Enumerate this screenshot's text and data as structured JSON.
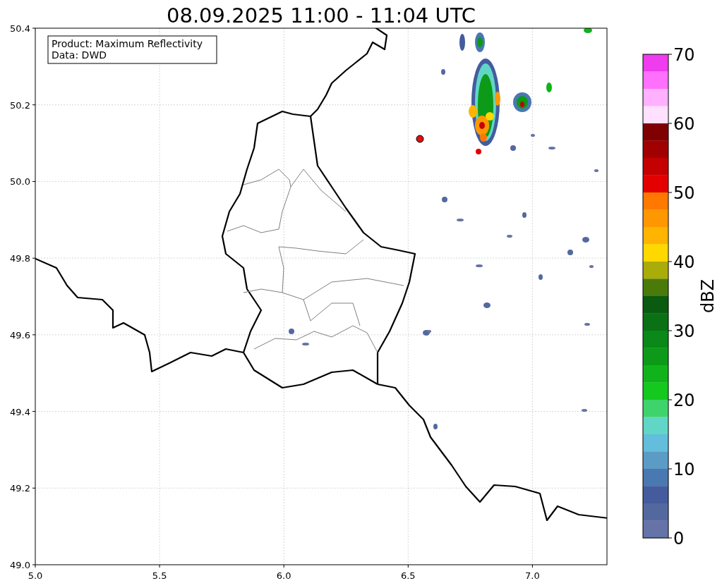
{
  "title": "08.09.2025 11:00 - 11:04 UTC",
  "info_box": [
    "Product: Maximum Reflectivity",
    "Data: DWD"
  ],
  "map": {
    "x_ticks": [
      "5.0",
      "5.5",
      "6.0",
      "6.5",
      "7.0"
    ],
    "y_ticks": [
      "50.4",
      "50.2",
      "50.0",
      "49.8",
      "49.6",
      "49.4",
      "49.2",
      "49.0"
    ]
  },
  "colorbar": {
    "label": "dBZ",
    "ticks": [
      "70",
      "60",
      "50",
      "40",
      "30",
      "20",
      "10",
      "0"
    ],
    "steps": [
      {
        "color": "#ee3cee"
      },
      {
        "color": "#ff70fe"
      },
      {
        "color": "#ffb0fe"
      },
      {
        "color": "#ffe0fe"
      },
      {
        "color": "#7e0000"
      },
      {
        "color": "#a00000"
      },
      {
        "color": "#c40000"
      },
      {
        "color": "#e40000"
      },
      {
        "color": "#ff7800"
      },
      {
        "color": "#ff9800"
      },
      {
        "color": "#ffb400"
      },
      {
        "color": "#ffd800"
      },
      {
        "color": "#aaac0a"
      },
      {
        "color": "#4a7a0a"
      },
      {
        "color": "#0a5a10"
      },
      {
        "color": "#0a7214"
      },
      {
        "color": "#0a8818"
      },
      {
        "color": "#0c9a18"
      },
      {
        "color": "#10b41a"
      },
      {
        "color": "#14c81e"
      },
      {
        "color": "#3ed46c"
      },
      {
        "color": "#62d6c6"
      },
      {
        "color": "#62bedc"
      },
      {
        "color": "#5a9cc6"
      },
      {
        "color": "#4a78b0"
      },
      {
        "color": "#445c9e"
      },
      {
        "color": "#5468a0"
      },
      {
        "color": "#6573a6"
      }
    ]
  }
}
